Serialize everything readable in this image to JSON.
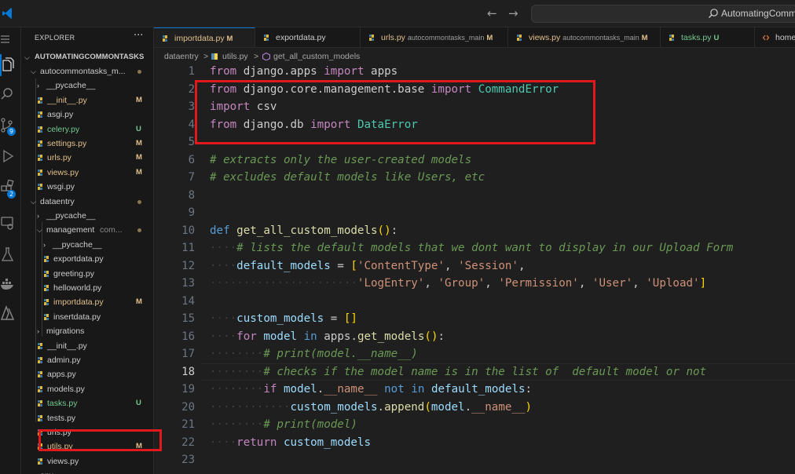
{
  "search": {
    "text": "AutomatingComm"
  },
  "activity_bar": {
    "badges": {
      "source_control": "9",
      "extensions": "2"
    }
  },
  "explorer": {
    "title": "EXPLORER",
    "more": "···",
    "root": "AUTOMATINGCOMMONTASKS",
    "items": [
      {
        "label": "autocommontasks_m...",
        "type": "folder-open",
        "depth": 1,
        "status": "dot"
      },
      {
        "label": "__pycache__",
        "type": "folder",
        "depth": 2
      },
      {
        "label": "__init__.py",
        "type": "py",
        "depth": 2,
        "status": "M"
      },
      {
        "label": "asgi.py",
        "type": "py",
        "depth": 2
      },
      {
        "label": "celery.py",
        "type": "py",
        "depth": 2,
        "status": "U"
      },
      {
        "label": "settings.py",
        "type": "py",
        "depth": 2,
        "status": "M"
      },
      {
        "label": "urls.py",
        "type": "py",
        "depth": 2,
        "status": "M"
      },
      {
        "label": "views.py",
        "type": "py",
        "depth": 2,
        "status": "M"
      },
      {
        "label": "wsgi.py",
        "type": "py",
        "depth": 2
      },
      {
        "label": "dataentry",
        "type": "folder-open",
        "depth": 1,
        "status": "dot"
      },
      {
        "label": "__pycache__",
        "type": "folder",
        "depth": 2
      },
      {
        "label": "management",
        "label_suffix": "com...",
        "type": "folder-open",
        "depth": 2,
        "status": "dot"
      },
      {
        "label": "__pycache__",
        "type": "folder",
        "depth": 3
      },
      {
        "label": "exportdata.py",
        "type": "py",
        "depth": 3
      },
      {
        "label": "greeting.py",
        "type": "py",
        "depth": 3
      },
      {
        "label": "helloworld.py",
        "type": "py",
        "depth": 3
      },
      {
        "label": "importdata.py",
        "type": "py",
        "depth": 3,
        "status": "M"
      },
      {
        "label": "insertdata.py",
        "type": "py",
        "depth": 3
      },
      {
        "label": "migrations",
        "type": "folder",
        "depth": 2
      },
      {
        "label": "__init__.py",
        "type": "py",
        "depth": 2
      },
      {
        "label": "admin.py",
        "type": "py",
        "depth": 2
      },
      {
        "label": "apps.py",
        "type": "py",
        "depth": 2
      },
      {
        "label": "models.py",
        "type": "py",
        "depth": 2
      },
      {
        "label": "tasks.py",
        "type": "py",
        "depth": 2,
        "status": "U"
      },
      {
        "label": "tests.py",
        "type": "py",
        "depth": 2
      },
      {
        "label": "urls.py",
        "type": "py",
        "depth": 2
      },
      {
        "label": "utils.py",
        "type": "py",
        "depth": 2,
        "status": "M"
      },
      {
        "label": "views.py",
        "type": "py",
        "depth": 2
      },
      {
        "label": "env",
        "type": "folder",
        "depth": 1
      }
    ]
  },
  "tabs": [
    {
      "label": "importdata.py",
      "suffix": "",
      "status": "M",
      "color": "#e2c08d"
    },
    {
      "label": "exportdata.py",
      "suffix": "",
      "status": "",
      "color": "#cccccc"
    },
    {
      "label": "urls.py",
      "suffix": "autocommontasks_main",
      "status": "M",
      "color": "#e2c08d"
    },
    {
      "label": "views.py",
      "suffix": "autocommontasks_main",
      "status": "M",
      "color": "#e2c08d"
    },
    {
      "label": "tasks.py",
      "suffix": "",
      "status": "U",
      "color": "#73c991"
    },
    {
      "label": "home",
      "suffix": "",
      "status": "",
      "color": "#cccccc"
    }
  ],
  "breadcrumb": {
    "folder": "dataentry",
    "sep": ">",
    "file": "utils.py",
    "symbol": "get_all_custom_models"
  },
  "editor": {
    "current_line": 18,
    "line_numbers": [
      "1",
      "2",
      "3",
      "4",
      "5",
      "6",
      "7",
      "8",
      "9",
      "10",
      "11",
      "12",
      "13",
      "14",
      "15",
      "16",
      "17",
      "18",
      "19",
      "20",
      "21",
      "22",
      "23"
    ],
    "tokens": {
      "from": "from",
      "import": "import",
      "def": "def",
      "for": "for",
      "in": "in",
      "if": "if",
      "not": "not",
      "return": "return",
      "django_apps": "django.apps",
      "apps": "apps",
      "django_core": "django.core.management.base",
      "CommandError": "CommandError",
      "csv": "csv",
      "django_db": "django.db",
      "DataError": "DataError",
      "comment6": "# extracts only the user-created models",
      "comment7": "# excludes default models like Users, etc",
      "fn_name": "get_all_custom_models",
      "paren_open": "(",
      "paren_close": ")",
      "colon": ":",
      "comment11": "# lists the default models that we dont want to display in our Upload Form",
      "default_models": "default_models",
      "eq": " = ",
      "brk_open": "[",
      "brk_close": "]",
      "s_ContentType": "'ContentType'",
      "s_Session": "'Session'",
      "s_LogEntry": "'LogEntry'",
      "s_Group": "'Group'",
      "s_Permission": "'Permission'",
      "s_User": "'User'",
      "s_Upload": "'Upload'",
      "comma": ", ",
      "comma_end": ",",
      "custom_models": "custom_models",
      "empty_list": "[]",
      "model": "model",
      "get_models": "get_models",
      "dot": ".",
      "comment17": "# print(model.__name__)",
      "comment18": "# checks if the model name is in the list of  default model or not",
      "dunder_name": "__name__",
      "append": "append",
      "comment21": "# print(model)"
    }
  }
}
